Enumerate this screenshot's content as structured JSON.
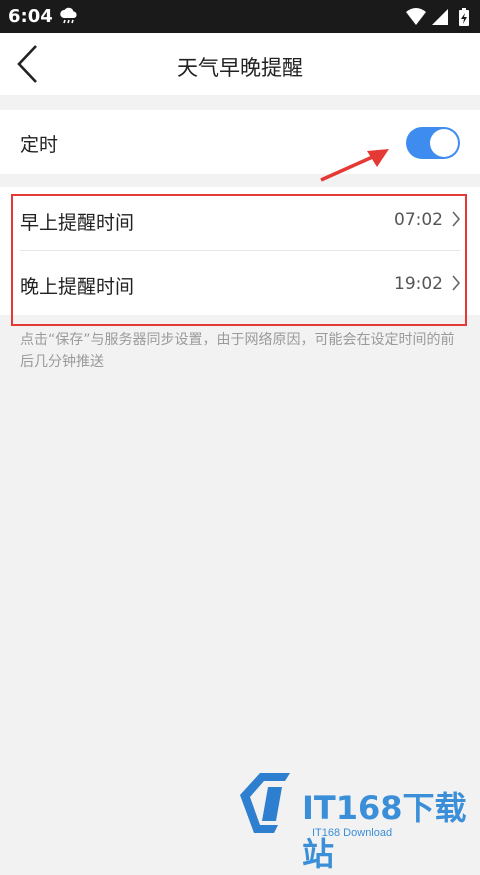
{
  "status_bar": {
    "time": "6:04",
    "icons": [
      "cloud-rain-icon",
      "wifi-icon",
      "signal-icon",
      "battery-charging-icon"
    ]
  },
  "app_bar": {
    "title": "天气早晚提醒",
    "back_icon": "chevron-left-icon"
  },
  "timer_row": {
    "label": "定时",
    "toggle_on": true,
    "toggle_color": "#3f8cf1"
  },
  "reminders": [
    {
      "label": "早上提醒时间",
      "value": "07:02"
    },
    {
      "label": "晚上提醒时间",
      "value": "19:02"
    }
  ],
  "note": "点击“保存”与服务器同步设置，由于网络原因，可能会在设定时间的前后几分钟推送",
  "annotation_color": "#e53935",
  "watermark": {
    "brand": "IT168下载站",
    "sub": "IT168 Download"
  }
}
